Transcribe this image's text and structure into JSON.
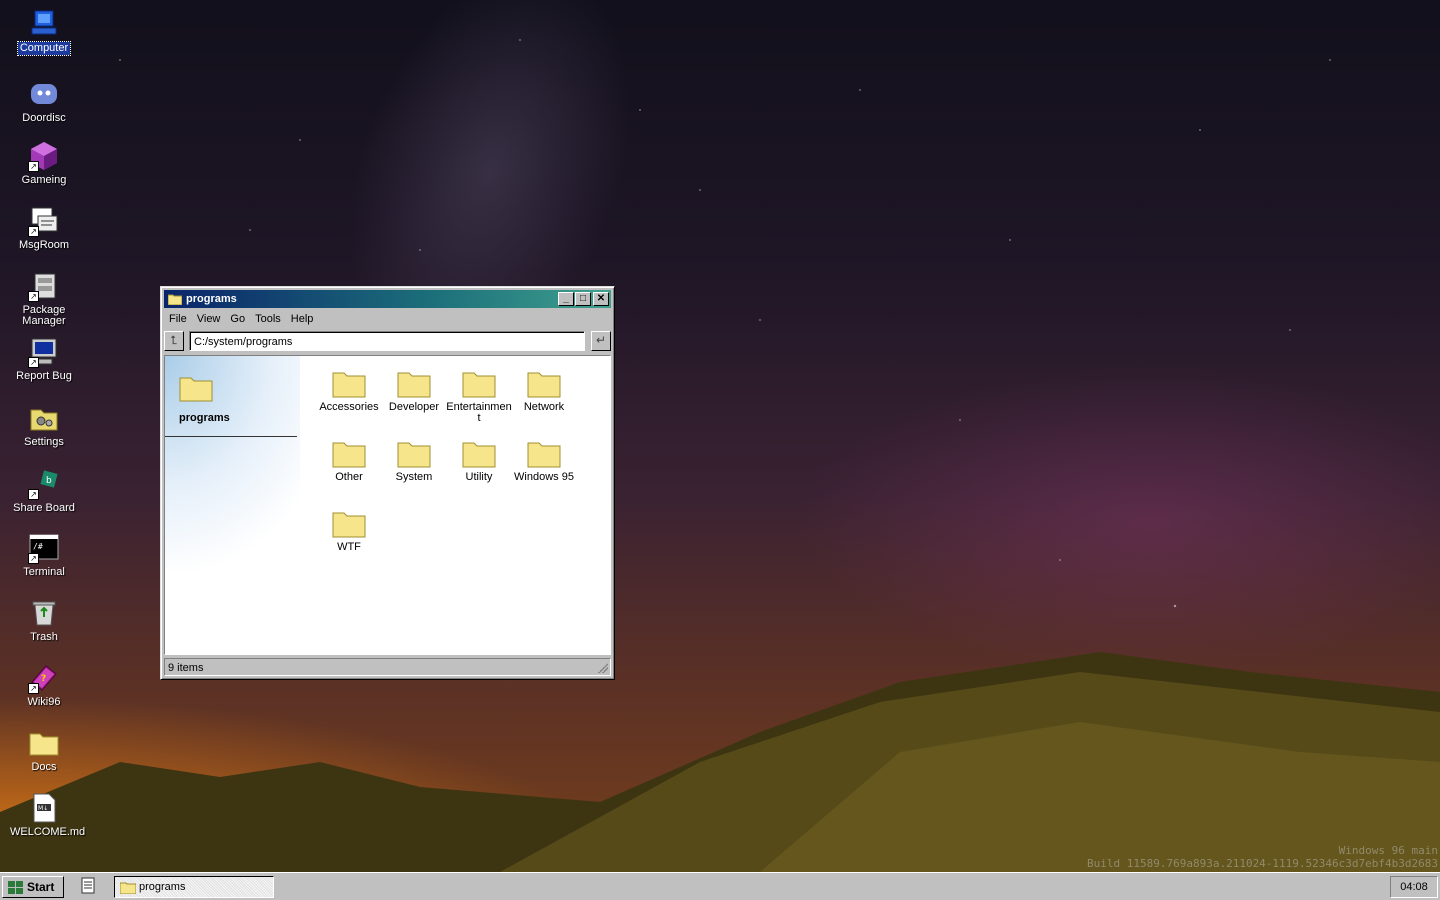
{
  "desktop": {
    "icons": [
      {
        "label": "Computer",
        "icon": "computer-icon",
        "selected": true
      },
      {
        "label": "Doordisc",
        "icon": "discord-icon"
      },
      {
        "label": "Gameing",
        "icon": "cube-icon"
      },
      {
        "label": "MsgRoom",
        "icon": "chat-icon"
      },
      {
        "label": "Package Manager",
        "icon": "package-icon"
      },
      {
        "label": "Report Bug",
        "icon": "bug-report-icon"
      },
      {
        "label": "Settings",
        "icon": "settings-icon"
      },
      {
        "label": "Share Board",
        "icon": "share-board-icon"
      },
      {
        "label": "Terminal",
        "icon": "terminal-icon"
      },
      {
        "label": "Trash",
        "icon": "trash-icon"
      },
      {
        "label": "Wiki96",
        "icon": "book-icon"
      },
      {
        "label": "Docs",
        "icon": "folder-icon"
      },
      {
        "label": "WELCOME.md",
        "icon": "markdown-file-icon"
      }
    ]
  },
  "window": {
    "title": "programs",
    "menu": [
      "File",
      "View",
      "Go",
      "Tools",
      "Help"
    ],
    "address": "C:/system/programs",
    "side_title": "programs",
    "items": [
      "Accessories",
      "Developer",
      "Entertainment",
      "Network",
      "Other",
      "System",
      "Utility",
      "Windows 95",
      "WTF"
    ],
    "status": "9 items"
  },
  "taskbar": {
    "start_label": "Start",
    "task_label": "programs",
    "clock": "04:08"
  },
  "watermark": {
    "line1": "Windows 96 main",
    "line2": "Build 11589.769a893a.211024-1119.52346c3d7ebf4b3d2683"
  },
  "colors": {
    "titlebar_start": "#0a246a",
    "titlebar_end": "#3fa08e",
    "folder": "#f6e58a",
    "chrome": "#c0c0c0"
  }
}
